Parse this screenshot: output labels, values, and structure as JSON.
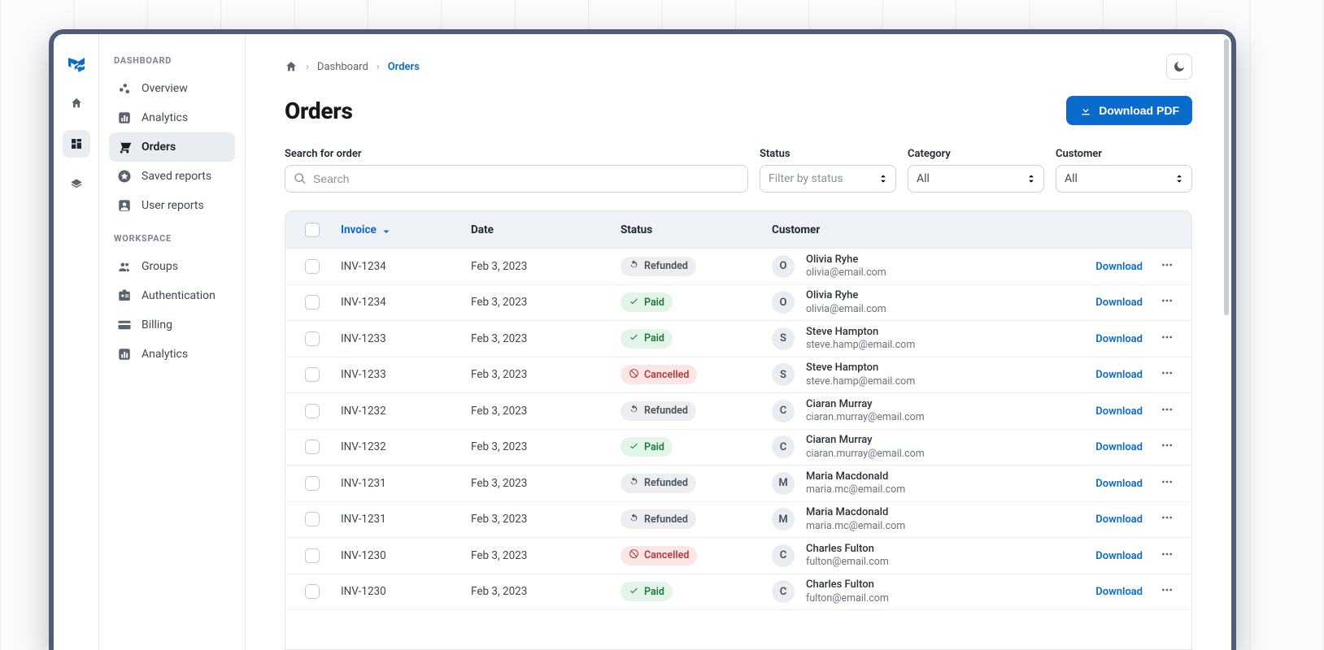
{
  "colors": {
    "primary": "#0b6bcb"
  },
  "rail": {
    "items": [
      {
        "name": "home",
        "active": false
      },
      {
        "name": "dashboard",
        "active": true
      },
      {
        "name": "layers",
        "active": false
      }
    ]
  },
  "sidebar": {
    "sections": [
      {
        "title": "DASHBOARD",
        "items": [
          {
            "label": "Overview",
            "icon": "scatter",
            "active": false
          },
          {
            "label": "Analytics",
            "icon": "barchart",
            "active": false
          },
          {
            "label": "Orders",
            "icon": "cart",
            "active": true
          },
          {
            "label": "Saved reports",
            "icon": "star",
            "active": false
          },
          {
            "label": "User reports",
            "icon": "account",
            "active": false
          }
        ]
      },
      {
        "title": "WORKSPACE",
        "items": [
          {
            "label": "Groups",
            "icon": "group",
            "active": false
          },
          {
            "label": "Authentication",
            "icon": "idcard",
            "active": false
          },
          {
            "label": "Billing",
            "icon": "card",
            "active": false
          },
          {
            "label": "Analytics",
            "icon": "barchart",
            "active": false
          }
        ]
      }
    ]
  },
  "breadcrumbs": {
    "items": [
      "Dashboard",
      "Orders"
    ]
  },
  "page": {
    "title": "Orders",
    "download_pdf_label": "Download PDF"
  },
  "filters": {
    "search": {
      "label": "Search for order",
      "placeholder": "Search",
      "value": ""
    },
    "status": {
      "label": "Status",
      "placeholder": "Filter by status",
      "value": ""
    },
    "category": {
      "label": "Category",
      "placeholder": "",
      "value": "All"
    },
    "customer": {
      "label": "Customer",
      "placeholder": "",
      "value": "All"
    }
  },
  "table": {
    "headers": {
      "invoice": "Invoice",
      "date": "Date",
      "status": "Status",
      "customer": "Customer"
    },
    "download_label": "Download",
    "rows": [
      {
        "invoice": "INV-1234",
        "date": "Feb 3, 2023",
        "status": "Refunded",
        "customer": {
          "initial": "O",
          "name": "Olivia Ryhe",
          "email": "olivia@email.com"
        }
      },
      {
        "invoice": "INV-1234",
        "date": "Feb 3, 2023",
        "status": "Paid",
        "customer": {
          "initial": "O",
          "name": "Olivia Ryhe",
          "email": "olivia@email.com"
        }
      },
      {
        "invoice": "INV-1233",
        "date": "Feb 3, 2023",
        "status": "Paid",
        "customer": {
          "initial": "S",
          "name": "Steve Hampton",
          "email": "steve.hamp@email.com"
        }
      },
      {
        "invoice": "INV-1233",
        "date": "Feb 3, 2023",
        "status": "Cancelled",
        "customer": {
          "initial": "S",
          "name": "Steve Hampton",
          "email": "steve.hamp@email.com"
        }
      },
      {
        "invoice": "INV-1232",
        "date": "Feb 3, 2023",
        "status": "Refunded",
        "customer": {
          "initial": "C",
          "name": "Ciaran Murray",
          "email": "ciaran.murray@email.com"
        }
      },
      {
        "invoice": "INV-1232",
        "date": "Feb 3, 2023",
        "status": "Paid",
        "customer": {
          "initial": "C",
          "name": "Ciaran Murray",
          "email": "ciaran.murray@email.com"
        }
      },
      {
        "invoice": "INV-1231",
        "date": "Feb 3, 2023",
        "status": "Refunded",
        "customer": {
          "initial": "M",
          "name": "Maria Macdonald",
          "email": "maria.mc@email.com"
        }
      },
      {
        "invoice": "INV-1231",
        "date": "Feb 3, 2023",
        "status": "Refunded",
        "customer": {
          "initial": "M",
          "name": "Maria Macdonald",
          "email": "maria.mc@email.com"
        }
      },
      {
        "invoice": "INV-1230",
        "date": "Feb 3, 2023",
        "status": "Cancelled",
        "customer": {
          "initial": "C",
          "name": "Charles Fulton",
          "email": "fulton@email.com"
        }
      },
      {
        "invoice": "INV-1230",
        "date": "Feb 3, 2023",
        "status": "Paid",
        "customer": {
          "initial": "C",
          "name": "Charles Fulton",
          "email": "fulton@email.com"
        }
      }
    ]
  }
}
